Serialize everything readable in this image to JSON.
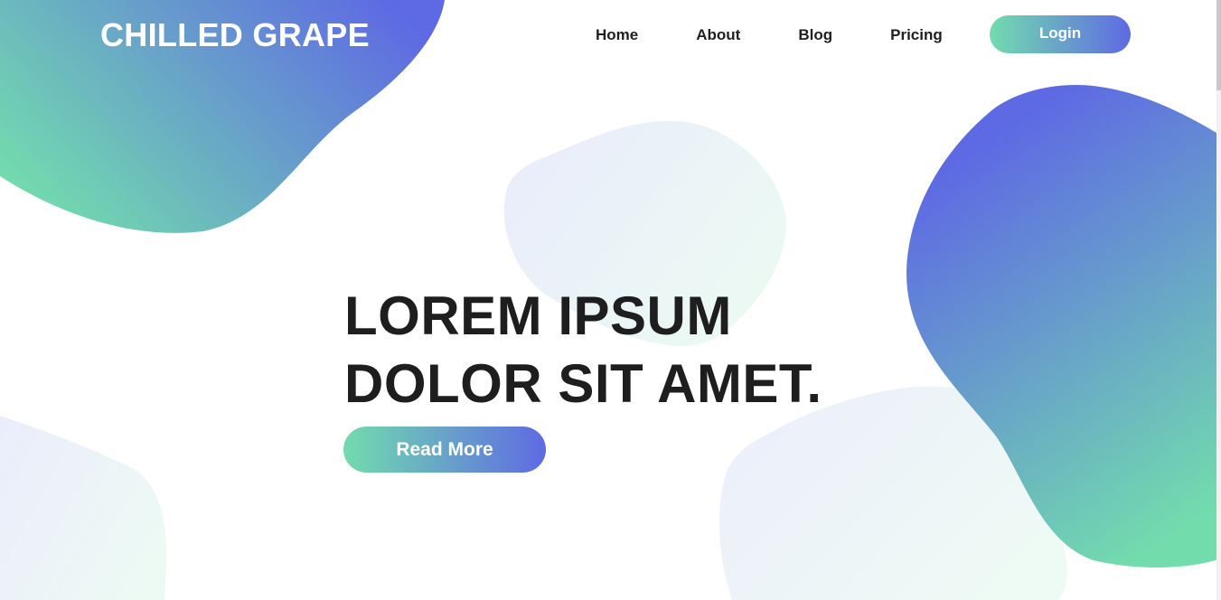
{
  "brand": {
    "name": "CHILLED GRAPE"
  },
  "nav": {
    "items": [
      {
        "label": "Home"
      },
      {
        "label": "About"
      },
      {
        "label": "Blog"
      },
      {
        "label": "Pricing"
      }
    ],
    "login_label": "Login"
  },
  "hero": {
    "line1": "LOREM IPSUM",
    "line2": "DOLOR SIT AMET.",
    "cta_label": "Read More"
  },
  "colors": {
    "gradient_start": "#72dcad",
    "gradient_end": "#5e6ae3",
    "heading_text": "#1e1e1e",
    "nav_text": "#1f1f1f",
    "background": "#ffffff"
  }
}
